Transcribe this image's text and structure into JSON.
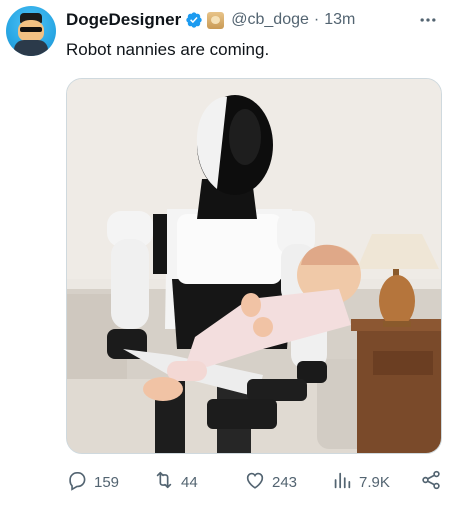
{
  "post": {
    "author_name": "DogeDesigner",
    "handle": "@cb_doge",
    "separator": "·",
    "time": "13m",
    "text": "Robot nannies are coming."
  },
  "icons": {
    "avatar": "doge-avatar",
    "verified": "verified-badge-icon",
    "affiliate": "doge-affiliate-badge",
    "more": "more-options-icon",
    "reply": "reply-icon",
    "repost": "repost-icon",
    "like": "heart-icon",
    "views": "views-icon",
    "share": "share-icon"
  },
  "metrics": {
    "replies": "159",
    "reposts": "44",
    "likes": "243",
    "views": "7.9K"
  },
  "colors": {
    "verified": "#1d9bf0",
    "secondary_text": "#536471",
    "primary_text": "#0f1419"
  }
}
